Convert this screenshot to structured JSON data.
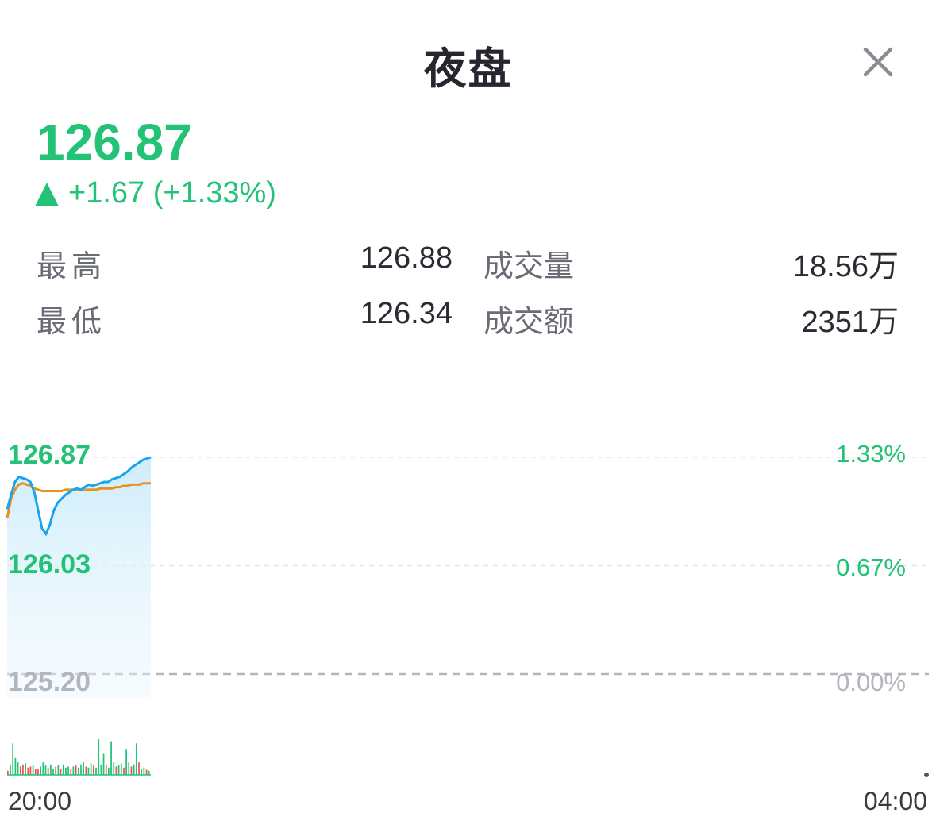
{
  "header": {
    "title": "夜盘",
    "close_icon": "close-icon"
  },
  "quote": {
    "price": "126.87",
    "change": "+1.67 (+1.33%)",
    "direction_icon": "triangle-up-icon",
    "color": "#22c277"
  },
  "stats": [
    {
      "label": "最高",
      "value": "126.88",
      "label2": "成交量",
      "value2": "18.56万"
    },
    {
      "label": "最低",
      "value": "126.34",
      "label2": "成交额",
      "value2": "2351万"
    }
  ],
  "chart_data": {
    "type": "line",
    "y_left_ticks": [
      "126.87",
      "126.03",
      "125.20"
    ],
    "y_right_ticks": [
      "1.33%",
      "0.67%",
      "0.00%"
    ],
    "x_ticks": [
      "20:00",
      "04:00"
    ],
    "ylim": [
      125.2,
      126.87
    ],
    "baseline": 125.2,
    "price_color": "#1aa3f0",
    "avg_color": "#e8921e",
    "up_color": "#22c277",
    "down_color": "#f05452",
    "series": [
      {
        "values": [
          126.47,
          126.58,
          126.68,
          126.72,
          126.71,
          126.7,
          126.68,
          126.6,
          126.46,
          126.32,
          126.28,
          126.35,
          126.46,
          126.52,
          126.55,
          126.58,
          126.6,
          126.62,
          126.63,
          126.62,
          126.64,
          126.66,
          126.65,
          126.66,
          126.67,
          126.68,
          126.68,
          126.7,
          126.71,
          126.72,
          126.74,
          126.76,
          126.79,
          126.81,
          126.83,
          126.85,
          126.86,
          126.87
        ]
      },
      {
        "values": [
          126.4,
          126.55,
          126.62,
          126.66,
          126.67,
          126.66,
          126.65,
          126.63,
          126.62,
          126.61,
          126.61,
          126.61,
          126.61,
          126.61,
          126.61,
          126.62,
          126.62,
          126.62,
          126.62,
          126.62,
          126.62,
          126.62,
          126.62,
          126.62,
          126.63,
          126.63,
          126.63,
          126.63,
          126.64,
          126.64,
          126.65,
          126.65,
          126.66,
          126.66,
          126.66,
          126.67,
          126.67,
          126.67
        ]
      }
    ],
    "volume": [
      {
        "v": 4,
        "up": false
      },
      {
        "v": 9,
        "up": true
      },
      {
        "v": 30,
        "up": true
      },
      {
        "v": 16,
        "up": true
      },
      {
        "v": 12,
        "up": true
      },
      {
        "v": 8,
        "up": false
      },
      {
        "v": 10,
        "up": false
      },
      {
        "v": 11,
        "up": true
      },
      {
        "v": 7,
        "up": false
      },
      {
        "v": 8,
        "up": false
      },
      {
        "v": 9,
        "up": true
      },
      {
        "v": 6,
        "up": false
      },
      {
        "v": 6,
        "up": false
      },
      {
        "v": 8,
        "up": true
      },
      {
        "v": 12,
        "up": true
      },
      {
        "v": 9,
        "up": true
      },
      {
        "v": 7,
        "up": false
      },
      {
        "v": 10,
        "up": true
      },
      {
        "v": 6,
        "up": true
      },
      {
        "v": 8,
        "up": false
      },
      {
        "v": 9,
        "up": true
      },
      {
        "v": 6,
        "up": false
      },
      {
        "v": 10,
        "up": true
      },
      {
        "v": 7,
        "up": true
      },
      {
        "v": 8,
        "up": true
      },
      {
        "v": 6,
        "up": false
      },
      {
        "v": 8,
        "up": true
      },
      {
        "v": 9,
        "up": false
      },
      {
        "v": 7,
        "up": true
      },
      {
        "v": 10,
        "up": true
      },
      {
        "v": 12,
        "up": true
      },
      {
        "v": 8,
        "up": false
      },
      {
        "v": 7,
        "up": true
      },
      {
        "v": 11,
        "up": true
      },
      {
        "v": 9,
        "up": false
      },
      {
        "v": 7,
        "up": true
      },
      {
        "v": 34,
        "up": true
      },
      {
        "v": 10,
        "up": true
      },
      {
        "v": 20,
        "up": true
      },
      {
        "v": 9,
        "up": false
      },
      {
        "v": 7,
        "up": true
      },
      {
        "v": 32,
        "up": true
      },
      {
        "v": 12,
        "up": true
      },
      {
        "v": 8,
        "up": false
      },
      {
        "v": 9,
        "up": true
      },
      {
        "v": 11,
        "up": true
      },
      {
        "v": 7,
        "up": false
      },
      {
        "v": 24,
        "up": true
      },
      {
        "v": 12,
        "up": true
      },
      {
        "v": 8,
        "up": false
      },
      {
        "v": 10,
        "up": true
      },
      {
        "v": 30,
        "up": true
      },
      {
        "v": 12,
        "up": false
      },
      {
        "v": 6,
        "up": true
      },
      {
        "v": 7,
        "up": true
      },
      {
        "v": 5,
        "up": false
      },
      {
        "v": 4,
        "up": true
      }
    ]
  }
}
